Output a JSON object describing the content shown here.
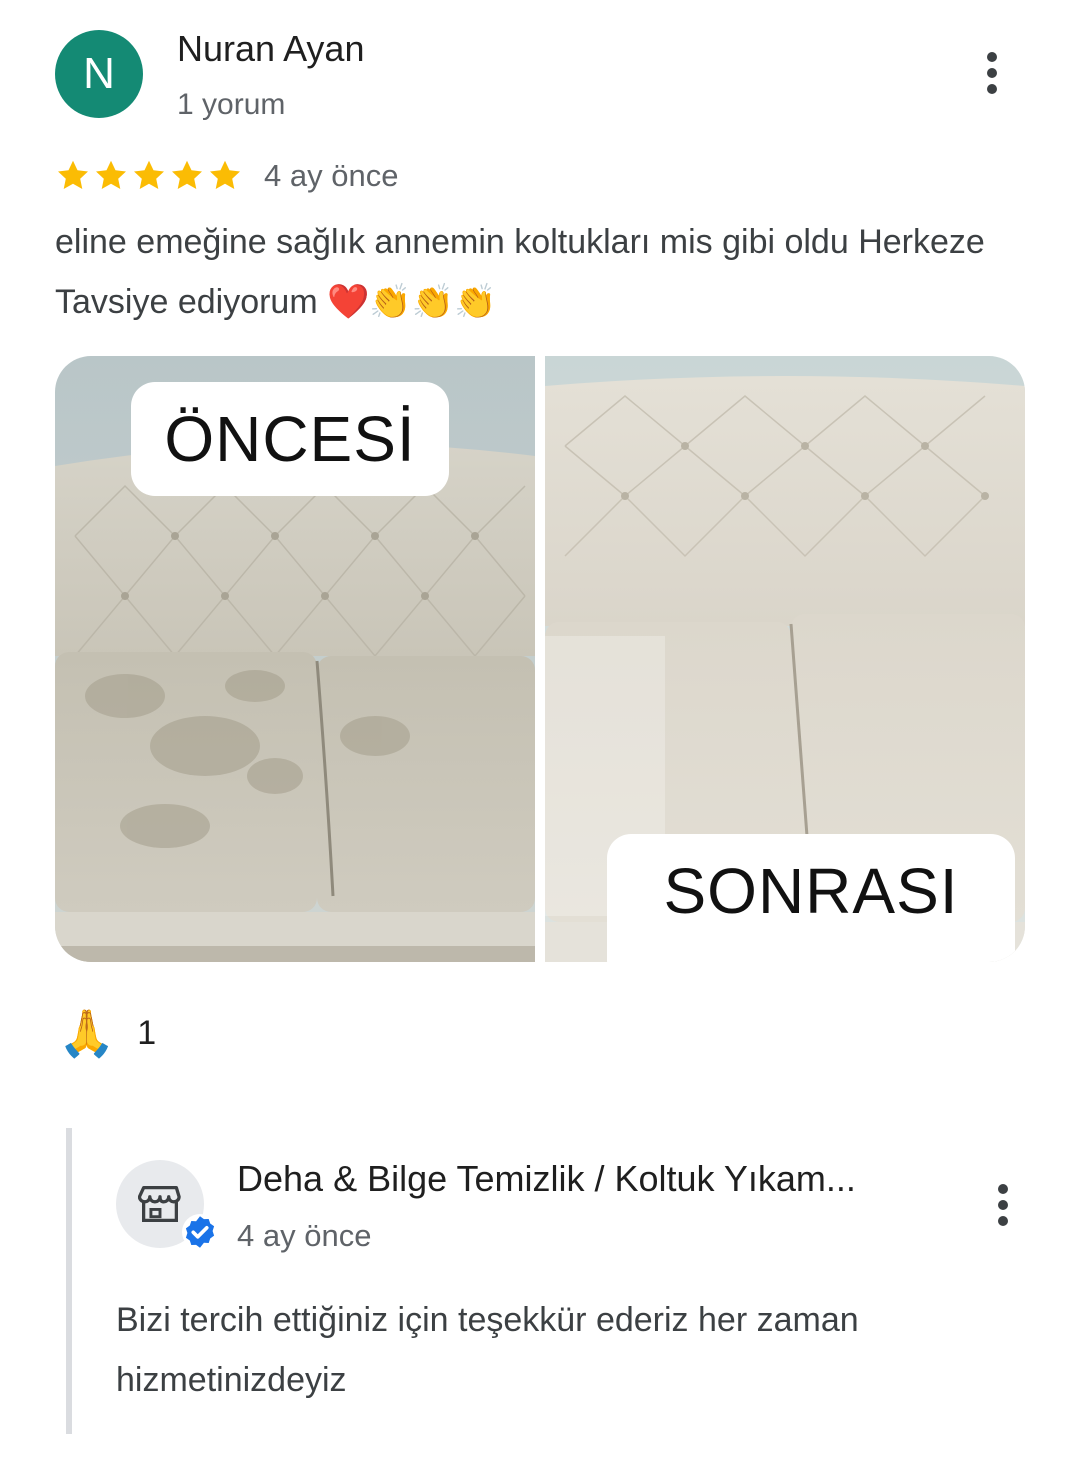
{
  "review": {
    "avatar_initial": "N",
    "avatar_color": "#148a74",
    "author": "Nuran Ayan",
    "review_count": "1 yorum",
    "rating": 5,
    "date": "4 ay önce",
    "text": "eline emeğine sağlık annemin koltukları mis gibi oldu Herkeze Tavsiye ediyorum ❤️👏👏👏",
    "menu_icon": "more-vert-icon"
  },
  "photos": {
    "before_label": "ÖNCESİ",
    "after_label": "SONRASI"
  },
  "reaction": {
    "emoji": "🙏",
    "count": "1"
  },
  "owner_reply": {
    "business_name": "Deha & Bilge Temizlik / Koltuk Yıkam...",
    "date": "4 ay önce",
    "text": "Bizi tercih ettiğiniz için teşekkür ederiz her zaman hizmetinizdeyiz",
    "avatar_icon": "store-icon",
    "badge_icon": "verified-icon",
    "badge_color": "#1a73e8",
    "menu_icon": "more-vert-icon"
  },
  "colors": {
    "star": "#fbbc04",
    "secondary_text": "#5f6368"
  }
}
